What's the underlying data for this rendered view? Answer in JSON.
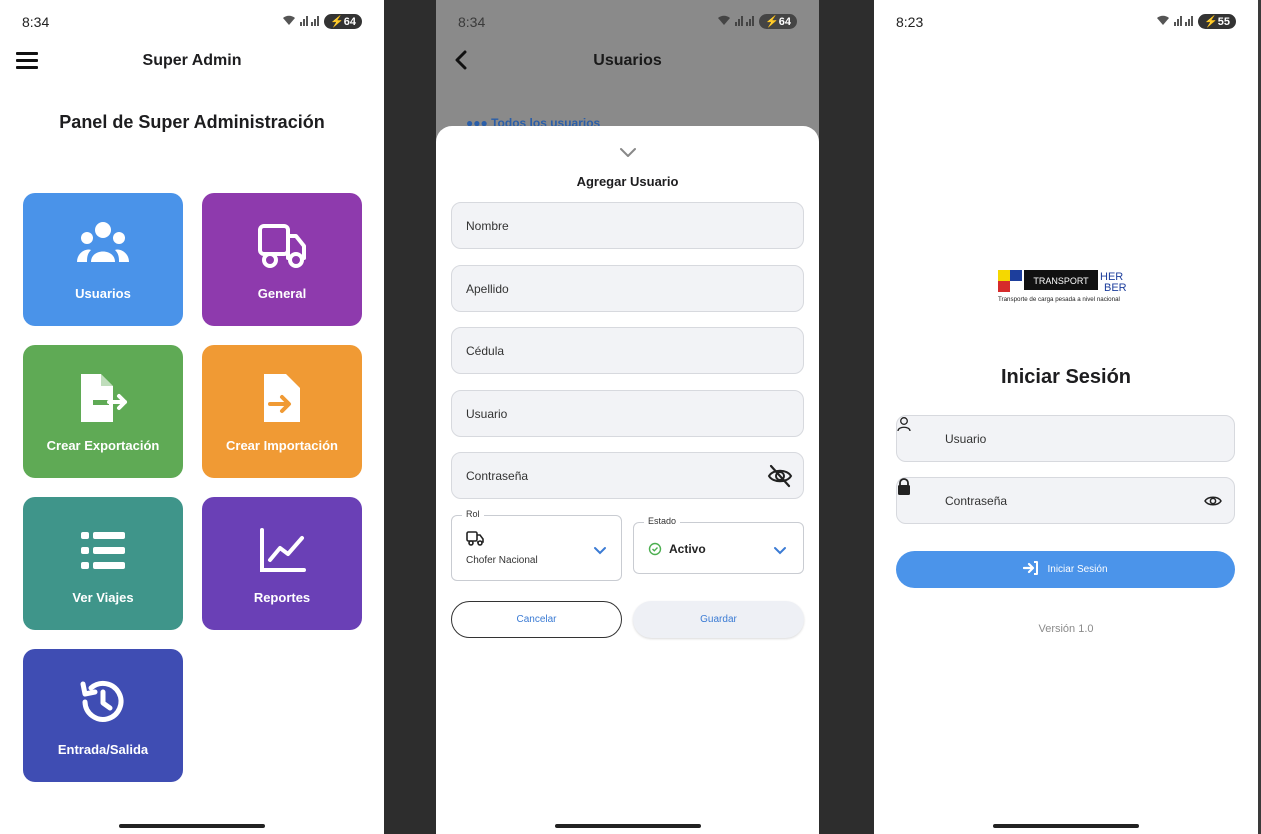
{
  "screen1": {
    "status_time": "8:34",
    "battery": "64",
    "appbar_title": "Super Admin",
    "panel_title": "Panel de Super Administración",
    "tiles": [
      {
        "label": "Usuarios",
        "color": "#4a93e9",
        "icon": "users-icon"
      },
      {
        "label": "General",
        "color": "#8e3aad",
        "icon": "truck-icon"
      },
      {
        "label": "Crear Exportación",
        "color": "#5faa55",
        "icon": "file-export-icon"
      },
      {
        "label": "Crear Importación",
        "color": "#f09a34",
        "icon": "file-import-icon"
      },
      {
        "label": "Ver Viajes",
        "color": "#3f958a",
        "icon": "list-icon"
      },
      {
        "label": "Reportes",
        "color": "#6a40b6",
        "icon": "chart-line-icon"
      },
      {
        "label": "Entrada/Salida",
        "color": "#3f4db3",
        "icon": "history-icon"
      }
    ]
  },
  "screen2": {
    "status_time": "8:34",
    "battery": "64",
    "appbar_title": "Usuarios",
    "behind_text": "Todos los usuarios",
    "sheet_title": "Agregar Usuario",
    "fields": {
      "nombre": "Nombre",
      "apellido": "Apellido",
      "cedula": "Cédula",
      "usuario": "Usuario",
      "contrasena": "Contraseña"
    },
    "rol": {
      "legend": "Rol",
      "value": "Chofer Nacional"
    },
    "estado": {
      "legend": "Estado",
      "value": "Activo"
    },
    "cancel_label": "Cancelar",
    "save_label": "Guardar",
    "accent_color": "#3b7bd4"
  },
  "screen3": {
    "status_time": "8:23",
    "battery": "55",
    "logo": {
      "word": "TRANSPORT",
      "brand_top": "HER",
      "brand_bottom": "BER",
      "tagline": "Transporte de carga pesada a nivel nacional"
    },
    "title": "Iniciar Sesión",
    "usuario_placeholder": "Usuario",
    "contrasena_placeholder": "Contraseña",
    "login_label": "Iniciar Sesión",
    "version": "Versión 1.0",
    "button_color": "#4b94ea"
  }
}
